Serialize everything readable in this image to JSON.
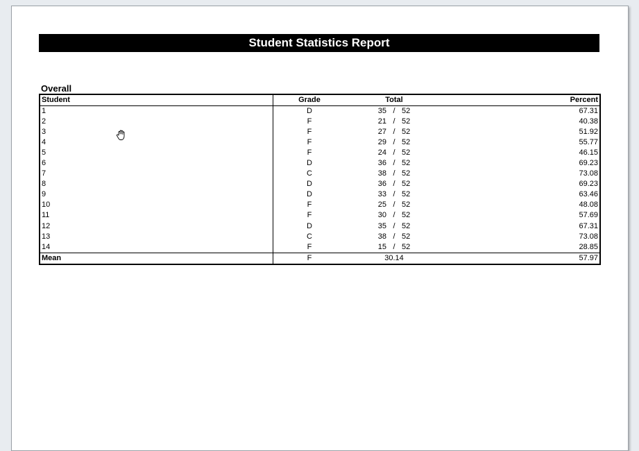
{
  "report": {
    "title": "Student Statistics Report",
    "section": "Overall"
  },
  "table": {
    "headers": {
      "student": "Student",
      "grade": "Grade",
      "total": "Total",
      "percent": "Percent"
    },
    "rows": [
      {
        "student": "1",
        "grade": "D",
        "score": "35",
        "sep": "/",
        "max": "52",
        "percent": "67.31"
      },
      {
        "student": "2",
        "grade": "F",
        "score": "21",
        "sep": "/",
        "max": "52",
        "percent": "40.38"
      },
      {
        "student": "3",
        "grade": "F",
        "score": "27",
        "sep": "/",
        "max": "52",
        "percent": "51.92"
      },
      {
        "student": "4",
        "grade": "F",
        "score": "29",
        "sep": "/",
        "max": "52",
        "percent": "55.77"
      },
      {
        "student": "5",
        "grade": "F",
        "score": "24",
        "sep": "/",
        "max": "52",
        "percent": "46.15"
      },
      {
        "student": "6",
        "grade": "D",
        "score": "36",
        "sep": "/",
        "max": "52",
        "percent": "69.23"
      },
      {
        "student": "7",
        "grade": "C",
        "score": "38",
        "sep": "/",
        "max": "52",
        "percent": "73.08"
      },
      {
        "student": "8",
        "grade": "D",
        "score": "36",
        "sep": "/",
        "max": "52",
        "percent": "69.23"
      },
      {
        "student": "9",
        "grade": "D",
        "score": "33",
        "sep": "/",
        "max": "52",
        "percent": "63.46"
      },
      {
        "student": "10",
        "grade": "F",
        "score": "25",
        "sep": "/",
        "max": "52",
        "percent": "48.08"
      },
      {
        "student": "11",
        "grade": "F",
        "score": "30",
        "sep": "/",
        "max": "52",
        "percent": "57.69"
      },
      {
        "student": "12",
        "grade": "D",
        "score": "35",
        "sep": "/",
        "max": "52",
        "percent": "67.31"
      },
      {
        "student": "13",
        "grade": "C",
        "score": "38",
        "sep": "/",
        "max": "52",
        "percent": "73.08"
      },
      {
        "student": "14",
        "grade": "F",
        "score": "15",
        "sep": "/",
        "max": "52",
        "percent": "28.85"
      }
    ],
    "mean": {
      "label": "Mean",
      "grade": "F",
      "total": "30.14",
      "percent": "57.97"
    }
  },
  "cursor": {
    "icon": "hand-grab-cursor-icon"
  }
}
